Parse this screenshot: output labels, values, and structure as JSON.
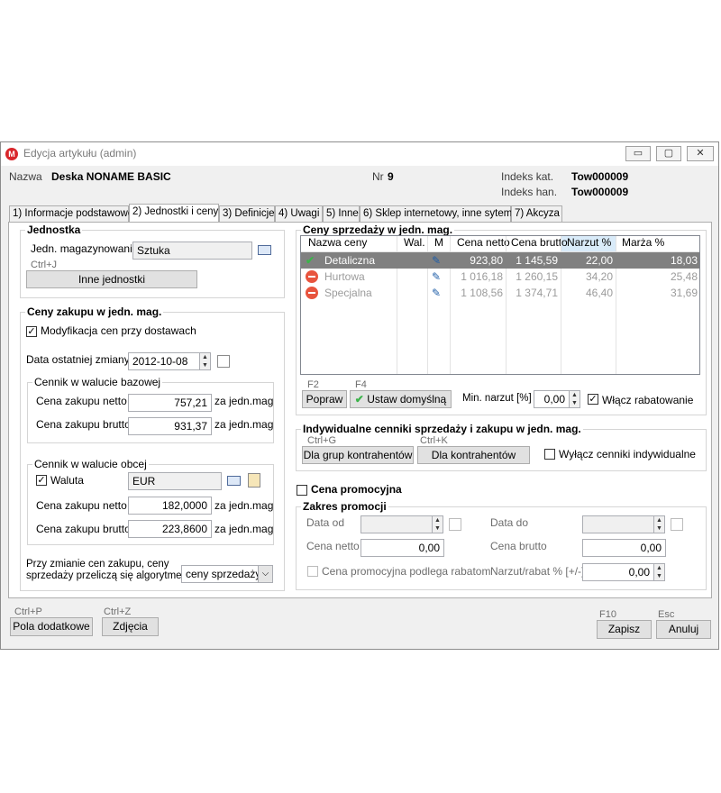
{
  "window": {
    "title": "Edycja artykułu (admin)",
    "app_icon_letter": "M",
    "minimize": "▭",
    "maximize": "▢",
    "close": "✕"
  },
  "header": {
    "name_label": "Nazwa",
    "name_value": "Deska NONAME BASIC",
    "nr_label": "Nr",
    "nr_value": "9",
    "indeks_kat_label": "Indeks kat.",
    "indeks_kat_value": "Tow000009",
    "indeks_han_label": "Indeks han.",
    "indeks_han_value": "Tow000009"
  },
  "tabs": [
    "1) Informacje podstawowe",
    "2) Jednostki i ceny",
    "3) Definicje",
    "4) Uwagi",
    "5) Inne",
    "6) Sklep internetowy, inne sytemy",
    "7) Akcyza"
  ],
  "unit": {
    "title": "Jednostka",
    "label": "Jedn. magazynowania",
    "value": "Sztuka",
    "hint": "Ctrl+J",
    "button": "Inne jednostki"
  },
  "purchase": {
    "title": "Ceny zakupu w jedn. mag.",
    "modify_checkbox": "Modyfikacja cen przy dostawach",
    "modify_checked": "✓",
    "last_change_label": "Data ostatniej zmiany",
    "last_change_value": "2012-10-08",
    "base": {
      "title": "Cennik w walucie bazowej",
      "netto_label": "Cena zakupu netto",
      "netto_value": "757,21",
      "brutto_label": "Cena zakupu brutto",
      "brutto_value": "931,37",
      "unit_suffix": "za jedn.mag"
    },
    "foreign": {
      "title": "Cennik w walucie obcej",
      "currency_checkbox": "Waluta",
      "currency_checked": "✓",
      "currency_value": "EUR",
      "netto_label": "Cena zakupu netto",
      "netto_value": "182,0000",
      "brutto_label": "Cena zakupu brutto",
      "brutto_value": "223,8600",
      "unit_suffix": "za jedn.mag"
    },
    "algo_label_1": "Przy zmianie cen zakupu, ceny",
    "algo_label_2": "sprzedaży przeliczą się algorytmem",
    "algo_value": "ceny sprzedaży",
    "algo_arrow": "⌵"
  },
  "sales": {
    "title": "Ceny sprzedaży w jedn. mag.",
    "columns": [
      "Nazwa ceny",
      "Wal.",
      "M",
      "Cena netto",
      "Cena brutto",
      "Narzut %",
      "Marża %"
    ],
    "rows": [
      {
        "name": "Detaliczna",
        "netto": "923,80",
        "brutto": "1 145,59",
        "narzut": "22,00",
        "marza": "18,03"
      },
      {
        "name": "Hurtowa",
        "netto": "1 016,18",
        "brutto": "1 260,15",
        "narzut": "34,20",
        "marza": "25,48"
      },
      {
        "name": "Specjalna",
        "netto": "1 108,56",
        "brutto": "1 374,71",
        "narzut": "46,40",
        "marza": "31,69"
      }
    ],
    "f2": "F2",
    "f4": "F4",
    "popraw": "Popraw",
    "ustaw": "Ustaw domyślną",
    "min_narzut_label": "Min. narzut [%]",
    "min_narzut_value": "0,00",
    "rabat_checkbox": "Włącz rabatowanie",
    "rabat_checked": "✓"
  },
  "indiv": {
    "title": "Indywidualne cenniki sprzedaży i zakupu w jedn. mag.",
    "hint_g": "Ctrl+G",
    "hint_k": "Ctrl+K",
    "btn_groups": "Dla grup kontrahentów",
    "btn_contractors": "Dla kontrahentów",
    "disable_checkbox": "Wyłącz cenniki indywidualne"
  },
  "promo": {
    "checkbox": "Cena promocyjna",
    "range_title": "Zakres promocji",
    "date_from_label": "Data od",
    "date_to_label": "Data do",
    "netto_label": "Cena netto",
    "netto_value": "0,00",
    "brutto_label": "Cena brutto",
    "brutto_value": "0,00",
    "rabat_checkbox": "Cena promocyjna podlega rabatom",
    "markup_label": "Narzut/rabat % [+/-]",
    "markup_value": "0,00"
  },
  "footer": {
    "hint_p": "Ctrl+P",
    "hint_z": "Ctrl+Z",
    "btn_fields": "Pola dodatkowe",
    "btn_photos": "Zdjęcia",
    "hint_f10": "F10",
    "hint_esc": "Esc",
    "btn_save": "Zapisz",
    "btn_cancel": "Anuluj"
  }
}
